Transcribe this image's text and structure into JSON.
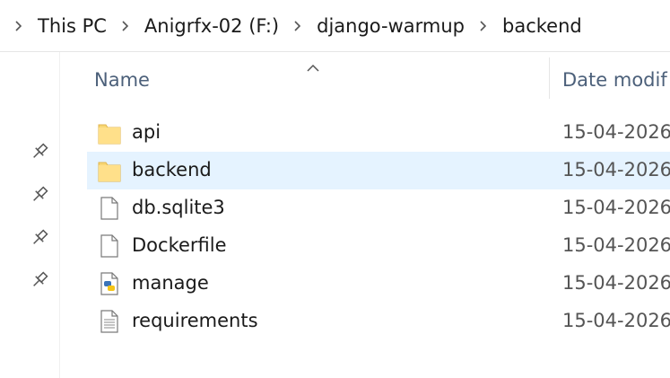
{
  "breadcrumb": {
    "items": [
      {
        "label": "This PC"
      },
      {
        "label": "Anigrfx-02 (F:)"
      },
      {
        "label": "django-warmup"
      },
      {
        "label": "backend"
      }
    ]
  },
  "columns": {
    "name": "Name",
    "date": "Date modif",
    "sort": "ascending"
  },
  "files": [
    {
      "name": "api",
      "date": "15-04-2026",
      "icon": "folder-icon",
      "selected": false
    },
    {
      "name": "backend",
      "date": "15-04-2026",
      "icon": "folder-icon",
      "selected": true
    },
    {
      "name": "db.sqlite3",
      "date": "15-04-2026",
      "icon": "file-icon",
      "selected": false
    },
    {
      "name": "Dockerfile",
      "date": "15-04-2026",
      "icon": "file-icon",
      "selected": false
    },
    {
      "name": "manage",
      "date": "15-04-2026",
      "icon": "python-file-icon",
      "selected": false
    },
    {
      "name": "requirements",
      "date": "15-04-2026",
      "icon": "text-file-icon",
      "selected": false
    }
  ],
  "quick_access_pins": 4,
  "colors": {
    "selection": "#e5f3ff",
    "header_text": "#4c607a",
    "folder": "#f8d775"
  }
}
